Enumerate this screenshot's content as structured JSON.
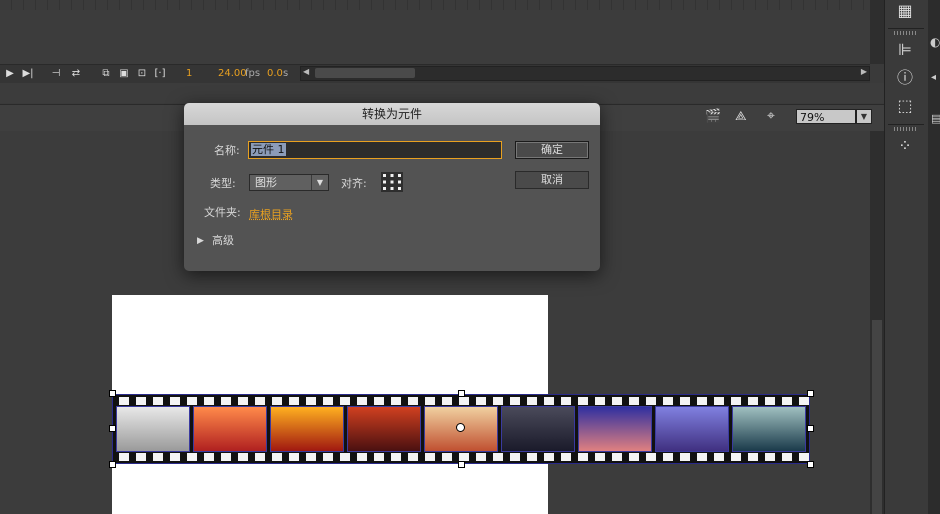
{
  "timeline": {
    "frame_number": "1",
    "fps_value": "24.00",
    "fps_unit": "fps",
    "time_value": "0.0",
    "time_unit": "s"
  },
  "editor_bar": {
    "zoom_level": "79%"
  },
  "dialog": {
    "title": "转换为元件",
    "name_label": "名称:",
    "name_value": "元件 1",
    "ok_label": "确定",
    "cancel_label": "取消",
    "type_label": "类型:",
    "type_value": "图形",
    "align_label": "对齐:",
    "folder_label": "文件夹:",
    "folder_value": "库根目录",
    "advanced_label": "高级"
  },
  "film_strip": {
    "frames": [
      {
        "colors": [
          "#e8e8e8",
          "#9a9a9a"
        ]
      },
      {
        "colors": [
          "#ff8a4a",
          "#b02020"
        ]
      },
      {
        "colors": [
          "#ffb020",
          "#a01810"
        ]
      },
      {
        "colors": [
          "#d04020",
          "#4a1010"
        ]
      },
      {
        "colors": [
          "#f0d0a0",
          "#c05030"
        ]
      },
      {
        "colors": [
          "#4a4a5a",
          "#1a1a2a"
        ]
      },
      {
        "colors": [
          "#3030a0",
          "#e08080"
        ]
      },
      {
        "colors": [
          "#8080e0",
          "#403080"
        ]
      },
      {
        "colors": [
          "#a0c0c0",
          "#1a3a4a"
        ]
      }
    ]
  }
}
